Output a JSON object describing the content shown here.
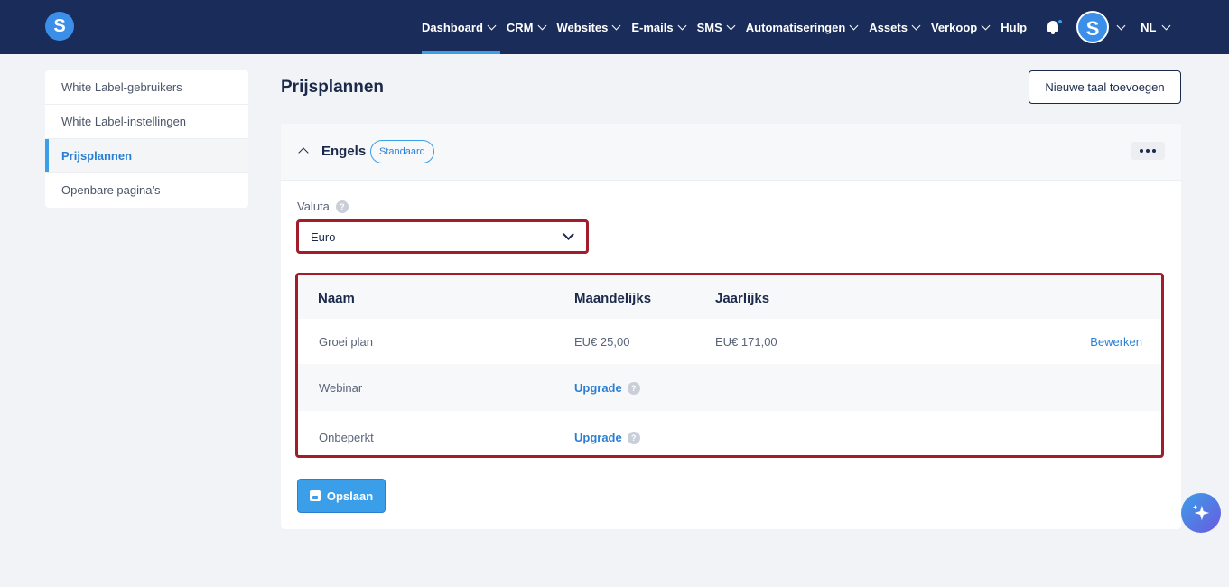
{
  "brand": {
    "logo_letter": "S"
  },
  "nav": {
    "items": [
      {
        "label": "Dashboard",
        "dropdown": true
      },
      {
        "label": "CRM",
        "dropdown": true
      },
      {
        "label": "Websites",
        "dropdown": true
      },
      {
        "label": "E-mails",
        "dropdown": true
      },
      {
        "label": "SMS",
        "dropdown": true
      },
      {
        "label": "Automatiseringen",
        "dropdown": true
      },
      {
        "label": "Assets",
        "dropdown": true
      },
      {
        "label": "Verkoop",
        "dropdown": true
      },
      {
        "label": "Hulp",
        "dropdown": false
      }
    ],
    "active": "Dashboard",
    "avatar_letter": "S",
    "language": "NL"
  },
  "sidebar": {
    "items": [
      {
        "label": "White Label-gebruikers"
      },
      {
        "label": "White Label-instellingen"
      },
      {
        "label": "Prijsplannen"
      },
      {
        "label": "Openbare pagina's"
      }
    ],
    "active": "Prijsplannen"
  },
  "page": {
    "title": "Prijsplannen",
    "add_language_label": "Nieuwe taal toevoegen"
  },
  "section": {
    "language": "Engels",
    "badge": "Standaard",
    "currency_label": "Valuta",
    "currency_value": "Euro",
    "help_glyph": "?",
    "save_label": "Opslaan"
  },
  "table": {
    "columns": [
      "Naam",
      "Maandelijks",
      "Jaarlijks"
    ],
    "rows": [
      {
        "name": "Groei plan",
        "monthly": "EU€ 25,00",
        "yearly": "EU€ 171,00",
        "action": "Bewerken"
      },
      {
        "name": "Webinar",
        "monthly": "Upgrade",
        "yearly": "",
        "action": ""
      },
      {
        "name": "Onbeperkt",
        "monthly": "Upgrade",
        "yearly": "",
        "action": ""
      }
    ]
  },
  "colors": {
    "navbar": "#1a2d5a",
    "accent": "#3b9ee8",
    "highlight_border": "#a11d2a",
    "background": "#f1f3f6"
  },
  "icons": {
    "notification": "bell-icon",
    "assistant": "sparkle-icon",
    "save": "floppy-disk-icon",
    "more": "more-horizontal-icon"
  }
}
